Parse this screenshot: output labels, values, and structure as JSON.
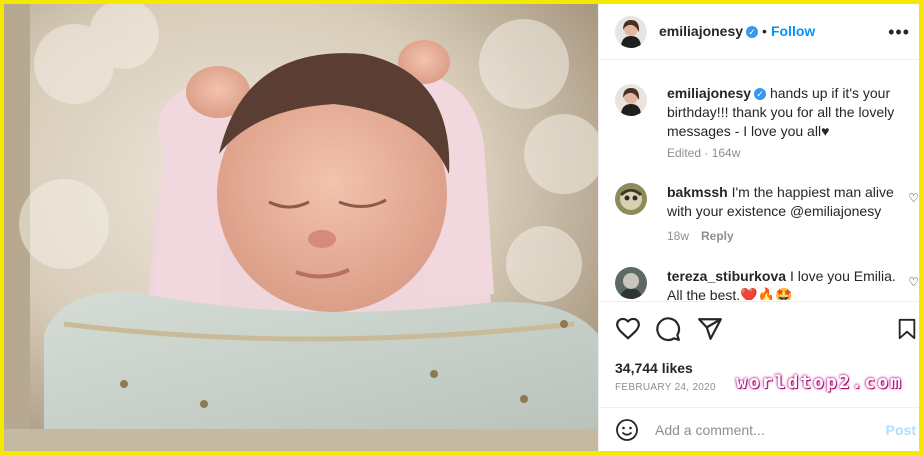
{
  "post": {
    "username": "emiliajonesy",
    "follow_label": "Follow",
    "more_icon": "more-options-icon",
    "caption": "hands up if it's your birthday!!! thank you for all the lovely messages - I love you all♥",
    "caption_meta": "Edited · 164w"
  },
  "comments": [
    {
      "username": "bakmssh",
      "text": "I'm the happiest man alive with your existence @emiliajonesy",
      "age": "18w",
      "reply_label": "Reply"
    },
    {
      "username": "tereza_stiburkova",
      "text": "I love you Emilia. All the best.❤️🔥🤩"
    }
  ],
  "actions": {
    "icons": [
      "heart-icon",
      "comment-icon",
      "share-icon",
      "bookmark-icon"
    ],
    "likes": "34,744 likes",
    "date": "FEBRUARY 24, 2020"
  },
  "add_comment": {
    "placeholder": "Add a comment...",
    "post_label": "Post",
    "emoji_icon": "emoji-icon"
  },
  "watermark": "worldtop2.com",
  "colors": {
    "border": "#f5e900",
    "link": "#0095f6",
    "verified": "#3897f0",
    "muted": "#8e8e8e"
  }
}
